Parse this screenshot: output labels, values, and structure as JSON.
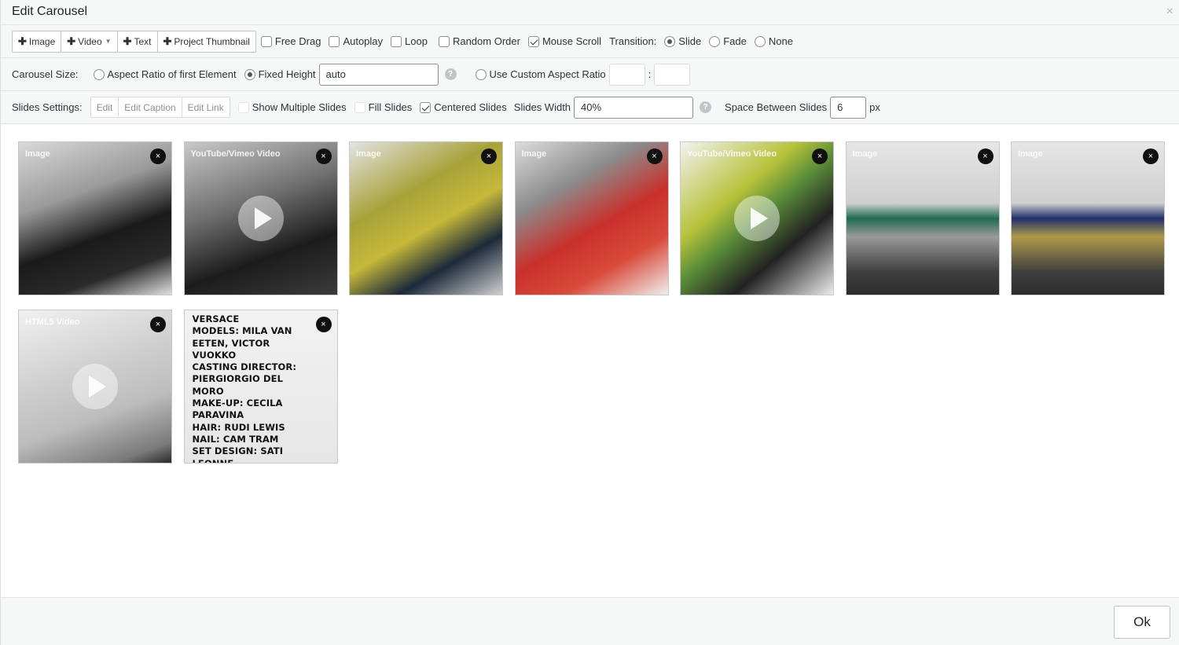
{
  "dialog": {
    "title": "Edit Carousel"
  },
  "toolbar": {
    "add_buttons": [
      "Image",
      "Video",
      "Text",
      "Project Thumbnail"
    ],
    "options": [
      {
        "label": "Free Drag",
        "checked": false
      },
      {
        "label": "Autoplay",
        "checked": false
      },
      {
        "label": "Loop",
        "checked": false
      },
      {
        "label": "Random Order",
        "checked": false
      },
      {
        "label": "Mouse Scroll",
        "checked": true
      }
    ],
    "transition_label": "Transition:",
    "transitions": [
      {
        "label": "Slide",
        "checked": true
      },
      {
        "label": "Fade",
        "checked": false
      },
      {
        "label": "None",
        "checked": false
      }
    ]
  },
  "carousel_size": {
    "label": "Carousel Size:",
    "aspect_first": "Aspect Ratio of first Element",
    "fixed_height": "Fixed Height",
    "fixed_height_value": "auto",
    "custom_ratio": "Use Custom Aspect Ratio",
    "ratio_sep": ":"
  },
  "slides_settings": {
    "label": "Slides Settings:",
    "buttons": [
      "Edit",
      "Edit Caption",
      "Edit Link"
    ],
    "show_multiple": "Show Multiple Slides",
    "fill_slides": "Fill Slides",
    "centered_slides": "Centered Slides",
    "slides_width_label": "Slides Width",
    "slides_width_value": "40%",
    "space_between_label": "Space Between Slides",
    "space_between_value": "6",
    "space_unit": "px"
  },
  "slides": [
    {
      "type": "Image",
      "bg": "linear-gradient(160deg,#d9d9d9 0%,#9a9a9a 35%,#1a1a1a 60%,#2a2a2a 80%,#e0e0e0 100%)",
      "video": false
    },
    {
      "type": "YouTube/Vimeo Video",
      "bg": "linear-gradient(160deg,#c8c8c8 0%,#6f6f6f 40%,#1c1c1c 70%,#3b3b3b 100%)",
      "video": true
    },
    {
      "type": "Image",
      "bg": "linear-gradient(150deg,#e3e3e3 0%,#a8a23a 35%,#c6b83a 55%,#1d2a3a 75%,#d0d0d0 100%)",
      "video": false
    },
    {
      "type": "Image",
      "bg": "linear-gradient(150deg,#dcdcdc 0%,#8c8c8c 30%,#c9302c 55%,#d94a3a 75%,#efefef 100%)",
      "video": false
    },
    {
      "type": "YouTube/Vimeo Video",
      "bg": "linear-gradient(140deg,#f2f2f2 0%,#b7c23a 35%,#5a8c3a 50%,#222 70%,#ececec 100%)",
      "video": true
    },
    {
      "type": "Image",
      "bg": "linear-gradient(180deg,#e6e6e6 0%,#cfcfcf 40%,#1f6b52 50%,#9a9a9a 62%,#3f3f3f 85%,#2c2c2c 100%)",
      "video": false
    },
    {
      "type": "Image",
      "bg": "linear-gradient(180deg,#e6e6e6 0%,#cfcfcf 40%,#1f2f6b 50%,#b09a4a 62%,#3f3f3f 85%,#2c2c2c 100%)",
      "video": false
    },
    {
      "type": "HTML5 Video",
      "bg": "linear-gradient(160deg,#f1f1f1 0%,#cfcfcf 40%,#bdbdbd 65%,#7a7a7a 90%,#2a2a2a 100%)",
      "video": true
    },
    {
      "type": "Text",
      "bg": "linear-gradient(180deg,#f2f2f2 0%,#e6e6e6 100%)",
      "video": false,
      "lines": [
        "VERSACE",
        "MODELS: MILA VAN EETEN, VICTOR VUOKKO",
        "CASTING DIRECTOR: PIERGIORGIO DEL MORO",
        "MAKE-UP: CECILA PARAVINA",
        "HAIR: RUDI LEWIS",
        "NAIL: CAM TRAM",
        "SET DESIGN: SATI LEONNE"
      ]
    }
  ],
  "close_glyph": "×",
  "footer": {
    "ok_label": "Ok"
  },
  "icons": {
    "close": "close-icon",
    "help": "help-icon",
    "play": "play-icon",
    "plus": "plus-icon",
    "caret": "chevron-down-icon"
  }
}
